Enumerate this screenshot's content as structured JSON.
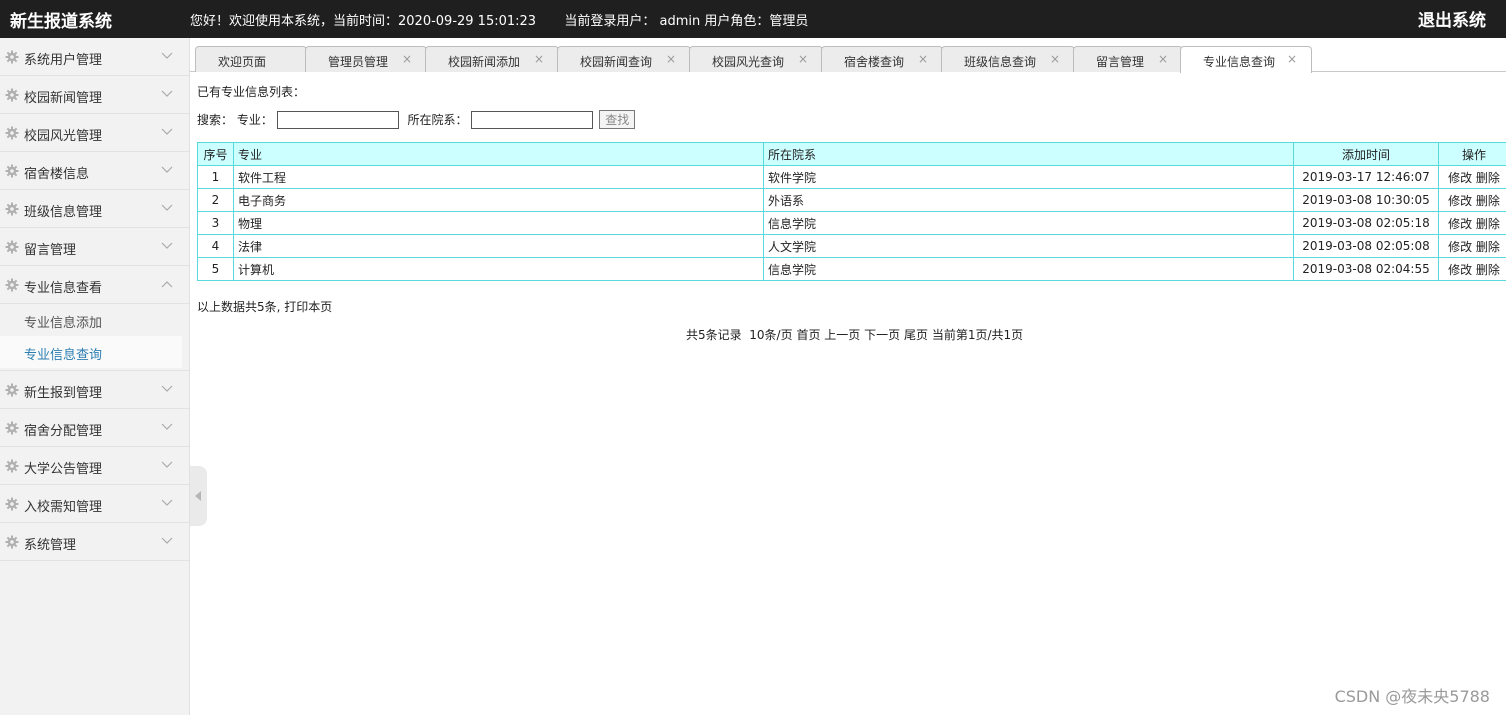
{
  "header": {
    "app_title": "新生报道系统",
    "welcome_text": "您好！欢迎使用本系统，当前时间：2020-09-29 15:01:23",
    "current_user_text": "当前登录用户： admin  用户角色：管理员",
    "logout_label": "退出系统"
  },
  "sidebar": {
    "items_top": [
      {
        "label": "系统用户管理"
      },
      {
        "label": "校园新闻管理"
      },
      {
        "label": "校园风光管理"
      },
      {
        "label": "宿舍楼信息"
      },
      {
        "label": "班级信息管理"
      },
      {
        "label": "留言管理"
      }
    ],
    "expanded_item": {
      "label": "专业信息查看",
      "children": [
        {
          "label": "专业信息添加",
          "active": false
        },
        {
          "label": "专业信息查询",
          "active": true
        }
      ]
    },
    "items_bottom": [
      {
        "label": "新生报到管理"
      },
      {
        "label": "宿舍分配管理"
      },
      {
        "label": "大学公告管理"
      },
      {
        "label": "入校需知管理"
      },
      {
        "label": "系统管理"
      }
    ]
  },
  "tabs": [
    {
      "label": "欢迎页面",
      "closable": false
    },
    {
      "label": "管理员管理",
      "closable": true
    },
    {
      "label": "校园新闻添加",
      "closable": true
    },
    {
      "label": "校园新闻查询",
      "closable": true
    },
    {
      "label": "校园风光查询",
      "closable": true
    },
    {
      "label": "宿舍楼查询",
      "closable": true
    },
    {
      "label": "班级信息查询",
      "closable": true
    },
    {
      "label": "留言管理",
      "closable": true
    },
    {
      "label": "专业信息查询",
      "closable": true,
      "active": true
    }
  ],
  "tab_close_glyph": "×",
  "content": {
    "list_title": "已有专业信息列表：",
    "search": {
      "prefix_label": "搜索：",
      "major_label": "专业：",
      "major_value": "",
      "dept_label": "所在院系：",
      "dept_value": "",
      "button_label": "查找"
    },
    "table": {
      "headers": [
        "序号",
        "专业",
        "所在院系",
        "添加时间",
        "操作"
      ],
      "rows": [
        {
          "idx": "1",
          "major": "软件工程",
          "dept": "软件学院",
          "time": "2019-03-17 12:46:07"
        },
        {
          "idx": "2",
          "major": "电子商务",
          "dept": "外语系",
          "time": "2019-03-08 10:30:05"
        },
        {
          "idx": "3",
          "major": "物理",
          "dept": "信息学院",
          "time": "2019-03-08 02:05:18"
        },
        {
          "idx": "4",
          "major": "法律",
          "dept": "人文学院",
          "time": "2019-03-08 02:05:08"
        },
        {
          "idx": "5",
          "major": "计算机",
          "dept": "信息学院",
          "time": "2019-03-08 02:04:55"
        }
      ],
      "edit_label": "修改",
      "delete_label": "删除"
    },
    "summary_text": "以上数据共5条,",
    "print_label": "打印本页",
    "pager": {
      "records": "共5条记录",
      "per_page": "10条/页",
      "first": "首页",
      "prev": "上一页",
      "next": "下一页",
      "last": "尾页",
      "current": "当前第1页/共1页"
    }
  },
  "watermark": "CSDN @夜未央5788",
  "colors": {
    "header_bg": "#1f1f1f",
    "sidebar_bg": "#f2f2f2",
    "table_border": "#59d9d9",
    "table_header_bg": "#ccffff",
    "active_sub_item": "#2d7fb2"
  }
}
